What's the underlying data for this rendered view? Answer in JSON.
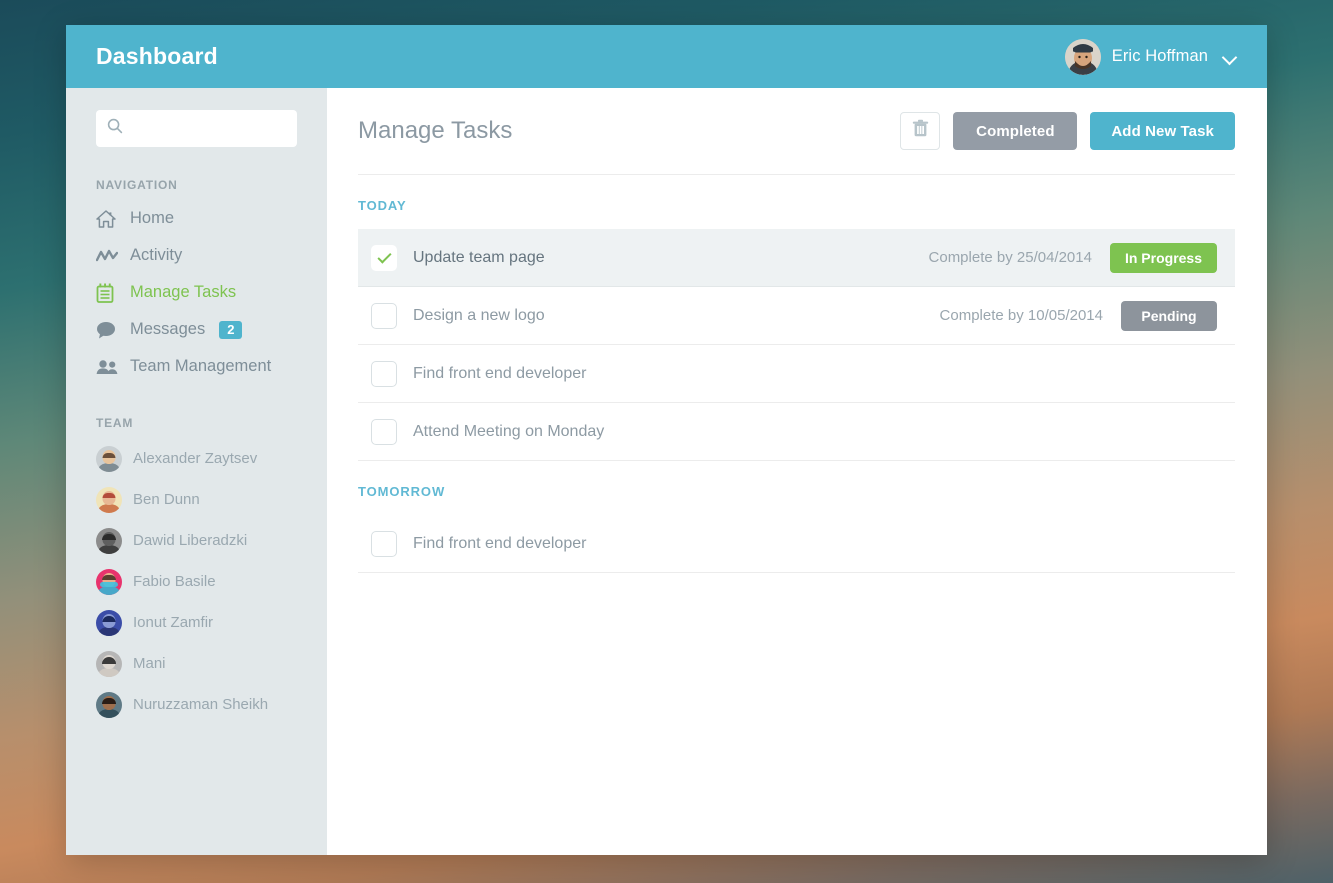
{
  "window": {
    "title": "Dashboard"
  },
  "user": {
    "name": "Eric Hoffman",
    "avatar_icon": "user-photo-avatar",
    "chevron_icon": "chevron-down-icon"
  },
  "sidebar": {
    "search": {
      "placeholder": "",
      "value": "",
      "icon": "search-icon"
    },
    "navigation_label": "NAVIGATION",
    "nav_items": [
      {
        "label": "Home",
        "icon": "home-icon",
        "active": false
      },
      {
        "label": "Activity",
        "icon": "activity-chart-icon",
        "active": false
      },
      {
        "label": "Manage Tasks",
        "icon": "notepad-icon",
        "active": true
      },
      {
        "label": "Messages",
        "icon": "chat-bubble-icon",
        "active": false,
        "badge": "2"
      },
      {
        "label": "Team Management",
        "icon": "people-icon",
        "active": false
      }
    ],
    "team_label": "TEAM",
    "team_members": [
      {
        "name": "Alexander Zaytsev",
        "avatar_bg": "#c9cfd2",
        "skin": "#e8c49c",
        "hair": "#6b4f3a"
      },
      {
        "name": "Ben Dunn",
        "avatar_bg": "#f0e4b8",
        "skin": "#e8b894",
        "hair": "#b34c3a"
      },
      {
        "name": "Dawid Liberadzki",
        "avatar_bg": "#8c8c8c",
        "skin": "#5f5f5f",
        "hair": "#2b2b2b"
      },
      {
        "name": "Fabio Basile",
        "avatar_bg": "#e8336d",
        "skin": "#e8b08c",
        "hair": "#5a4030"
      },
      {
        "name": "Ionut Zamfir",
        "avatar_bg": "#3b4da8",
        "skin": "#8a9bd4",
        "hair": "#1c2a5e"
      },
      {
        "name": "Mani",
        "avatar_bg": "#b6b6b6",
        "skin": "#ddd7d0",
        "hair": "#3a3a3a"
      },
      {
        "name": "Nuruzzaman Sheikh",
        "avatar_bg": "#5f7a86",
        "skin": "#9e6f4e",
        "hair": "#2a1d16"
      }
    ]
  },
  "main": {
    "page_title": "Manage Tasks",
    "delete_icon": "trash-icon",
    "completed_label": "Completed",
    "add_task_label": "Add New Task",
    "groups": [
      {
        "label": "TODAY",
        "tasks": [
          {
            "title": "Update team page",
            "checked": true,
            "highlight": true,
            "due": "Complete by 25/04/2014",
            "status": "In Progress",
            "status_type": "inprogress"
          },
          {
            "title": "Design a new logo",
            "checked": false,
            "highlight": false,
            "due": "Complete by 10/05/2014",
            "status": "Pending",
            "status_type": "pending"
          },
          {
            "title": "Find front end developer",
            "checked": false,
            "highlight": false,
            "due": "",
            "status": "",
            "status_type": ""
          },
          {
            "title": "Attend Meeting on Monday",
            "checked": false,
            "highlight": false,
            "due": "",
            "status": "",
            "status_type": ""
          }
        ]
      },
      {
        "label": "TOMORROW",
        "tasks": [
          {
            "title": "Find front end developer",
            "checked": false,
            "highlight": false,
            "due": "",
            "status": "",
            "status_type": ""
          }
        ]
      }
    ]
  },
  "colors": {
    "header_teal": "#4fb4cd",
    "accent_green": "#7ec350",
    "status_gray": "#8d949c",
    "sidebar_bg": "#e2e8ea",
    "group_label": "#61b9d4"
  }
}
